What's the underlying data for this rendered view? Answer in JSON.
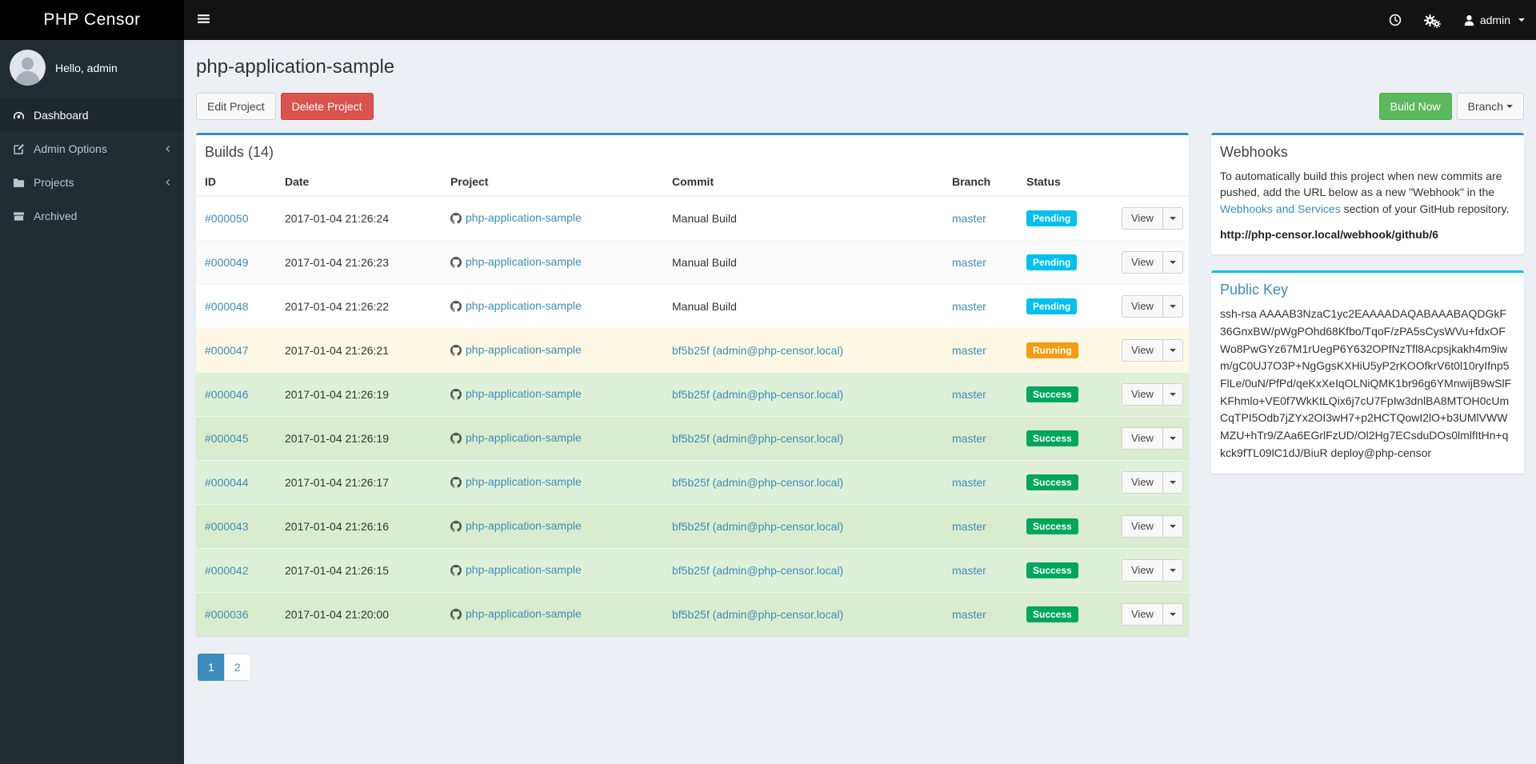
{
  "app": {
    "brand": "PHP Censor",
    "greeting": "Hello, admin",
    "user": "admin"
  },
  "sidebar": {
    "items": [
      {
        "label": "Dashboard"
      },
      {
        "label": "Admin Options"
      },
      {
        "label": "Projects"
      },
      {
        "label": "Archived"
      }
    ]
  },
  "page": {
    "title": "php-application-sample",
    "edit_button": "Edit Project",
    "delete_button": "Delete Project",
    "build_now_button": "Build Now",
    "branch_button": "Branch"
  },
  "builds": {
    "title": "Builds (14)",
    "columns": [
      "ID",
      "Date",
      "Project",
      "Commit",
      "Branch",
      "Status"
    ],
    "view_label": "View",
    "pagination": [
      "1",
      "2"
    ],
    "rows": [
      {
        "id": "#000050",
        "date": "2017-01-04 21:26:24",
        "project": "php-application-sample",
        "commit": "Manual Build",
        "commit_is_link": false,
        "branch": "master",
        "status": "Pending"
      },
      {
        "id": "#000049",
        "date": "2017-01-04 21:26:23",
        "project": "php-application-sample",
        "commit": "Manual Build",
        "commit_is_link": false,
        "branch": "master",
        "status": "Pending"
      },
      {
        "id": "#000048",
        "date": "2017-01-04 21:26:22",
        "project": "php-application-sample",
        "commit": "Manual Build",
        "commit_is_link": false,
        "branch": "master",
        "status": "Pending"
      },
      {
        "id": "#000047",
        "date": "2017-01-04 21:26:21",
        "project": "php-application-sample",
        "commit": "bf5b25f (admin@php-censor.local)",
        "commit_is_link": true,
        "branch": "master",
        "status": "Running"
      },
      {
        "id": "#000046",
        "date": "2017-01-04 21:26:19",
        "project": "php-application-sample",
        "commit": "bf5b25f (admin@php-censor.local)",
        "commit_is_link": true,
        "branch": "master",
        "status": "Success"
      },
      {
        "id": "#000045",
        "date": "2017-01-04 21:26:19",
        "project": "php-application-sample",
        "commit": "bf5b25f (admin@php-censor.local)",
        "commit_is_link": true,
        "branch": "master",
        "status": "Success"
      },
      {
        "id": "#000044",
        "date": "2017-01-04 21:26:17",
        "project": "php-application-sample",
        "commit": "bf5b25f (admin@php-censor.local)",
        "commit_is_link": true,
        "branch": "master",
        "status": "Success"
      },
      {
        "id": "#000043",
        "date": "2017-01-04 21:26:16",
        "project": "php-application-sample",
        "commit": "bf5b25f (admin@php-censor.local)",
        "commit_is_link": true,
        "branch": "master",
        "status": "Success"
      },
      {
        "id": "#000042",
        "date": "2017-01-04 21:26:15",
        "project": "php-application-sample",
        "commit": "bf5b25f (admin@php-censor.local)",
        "commit_is_link": true,
        "branch": "master",
        "status": "Success"
      },
      {
        "id": "#000036",
        "date": "2017-01-04 21:20:00",
        "project": "php-application-sample",
        "commit": "bf5b25f (admin@php-censor.local)",
        "commit_is_link": true,
        "branch": "master",
        "status": "Success"
      }
    ]
  },
  "webhooks": {
    "title": "Webhooks",
    "text_before": "To automatically build this project when new commits are pushed, add the URL below as a new \"Webhook\" in the ",
    "link": "Webhooks and Services",
    "text_after": " section of your GitHub repository.",
    "url": "http://php-censor.local/webhook/github/6"
  },
  "public_key": {
    "title": "Public Key",
    "key": "ssh-rsa AAAAB3NzaC1yc2EAAAADAQABAAABAQDGkF36GnxBW/pWgPOhd68Kfbo/TqoF/zPA5sCysWVu+fdxOFWo8PwGYz67M1rUegP6Y632OPfNzTfl8Acpsjkakh4m9iwm/gC0UJ7O3P+NgGgsKXHiU5yP2rKOOfkrV6t0l10ryIfnp5FlLe/0uN/PfPd/qeKxXeIqOLNiQMK1br96g6YMnwijB9wSlFKFhmlo+VE0f7WkKtLQix6j7cU7FpIw3dnlBA8MTOH0cUmCqTPI5Odb7jZYx2OI3wH7+p2HCTQowI2lO+b3UMlVWWMZU+hTr9/ZAa6EGrlFzUD/Ol2Hg7ECsduDOs0lmlfItHn+qkck9fTL09lC1dJ/BiuR deploy@php-censor"
  }
}
